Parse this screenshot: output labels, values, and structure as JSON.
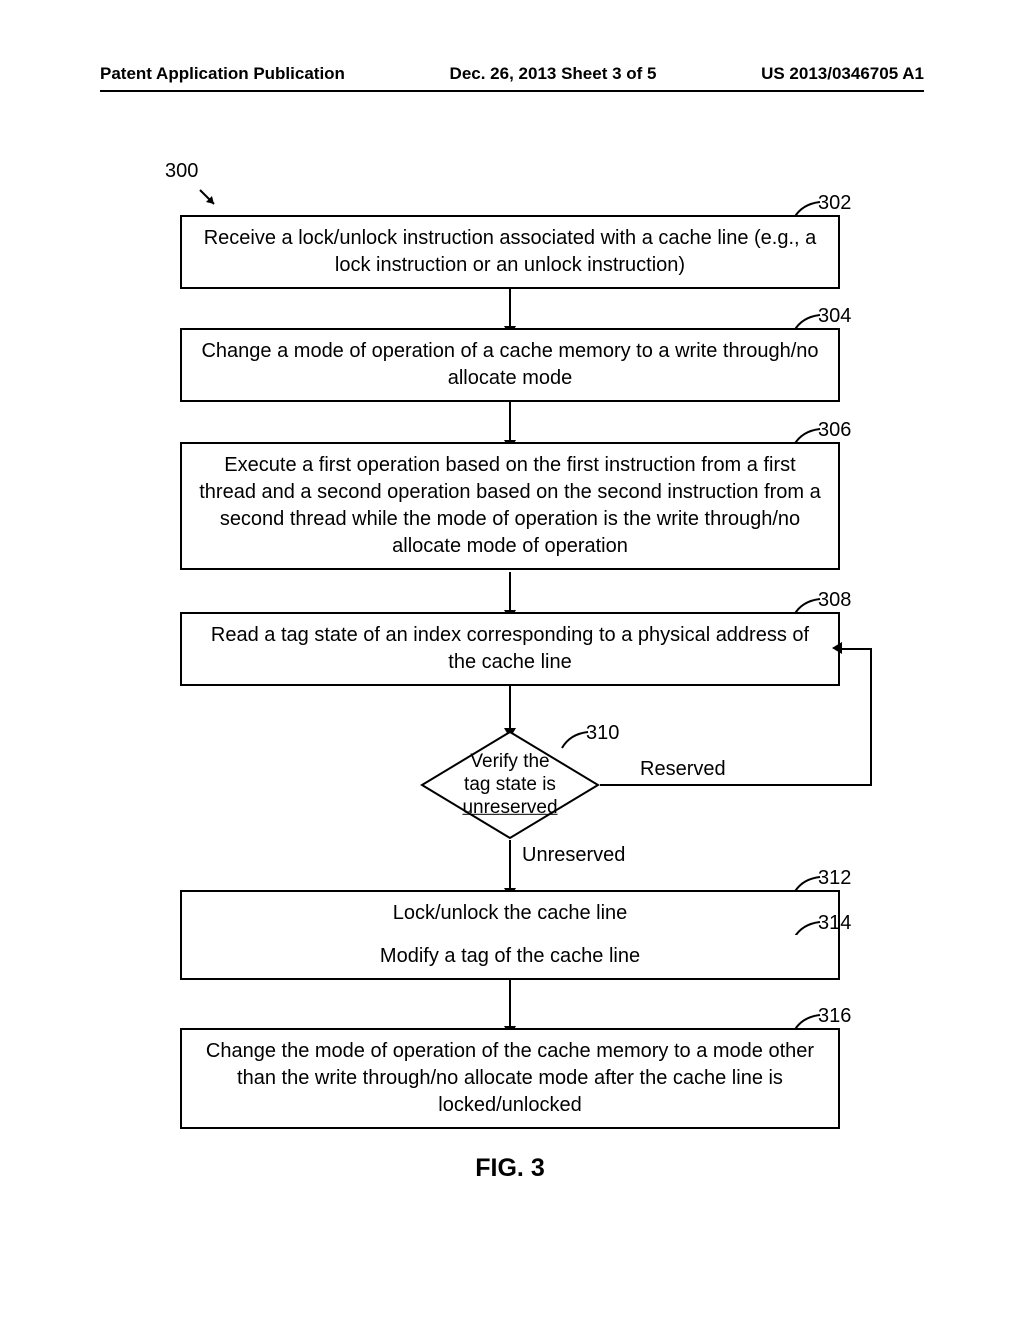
{
  "header": {
    "left": "Patent Application Publication",
    "center": "Dec. 26, 2013  Sheet 3 of 5",
    "right": "US 2013/0346705 A1"
  },
  "refs": {
    "r300": "300",
    "r302": "302",
    "r304": "304",
    "r306": "306",
    "r308": "308",
    "r310": "310",
    "r312": "312",
    "r314": "314",
    "r316": "316"
  },
  "boxes": {
    "b302": "Receive a lock/unlock instruction associated with a cache line (e.g., a lock instruction or an unlock instruction)",
    "b304": "Change a mode of operation of a cache memory to a write through/no allocate mode",
    "b306": "Execute a first operation based on the first instruction from a first thread and a second operation based on the second instruction from a second thread while the mode of operation is the write through/no allocate mode of operation",
    "b308": "Read a tag state of an index corresponding to a physical address of the cache line",
    "b312": "Lock/unlock the cache line",
    "b314": "Modify a tag of the cache line",
    "b316": "Change the mode of operation of the cache memory to a mode other than the write through/no allocate mode after the cache line is locked/unlocked"
  },
  "decision": {
    "line1": "Verify the",
    "line2": "tag state is",
    "line3": "unreserved",
    "right": "Reserved",
    "bottom": "Unreserved"
  },
  "caption": "FIG. 3",
  "chart_data": {
    "type": "flowchart",
    "title": "FIG. 3",
    "reference_numeral": "300",
    "nodes": [
      {
        "id": "302",
        "shape": "process",
        "text": "Receive a lock/unlock instruction associated with a cache line (e.g., a lock instruction or an unlock instruction)"
      },
      {
        "id": "304",
        "shape": "process",
        "text": "Change a mode of operation of a cache memory to a write through/no allocate mode"
      },
      {
        "id": "306",
        "shape": "process",
        "text": "Execute a first operation based on the first instruction from a first thread and a second operation based on the second instruction from a second thread while the mode of operation is the write through/no allocate mode of operation"
      },
      {
        "id": "308",
        "shape": "process",
        "text": "Read a tag state of an index corresponding to a physical address of the cache line"
      },
      {
        "id": "310",
        "shape": "decision",
        "text": "Verify the tag state is unreserved"
      },
      {
        "id": "312",
        "shape": "process",
        "text": "Lock/unlock the cache line"
      },
      {
        "id": "314",
        "shape": "process",
        "text": "Modify a tag of the cache line"
      },
      {
        "id": "316",
        "shape": "process",
        "text": "Change the mode of operation of the cache memory to a mode other than the write through/no allocate mode after the cache line is locked/unlocked"
      }
    ],
    "edges": [
      {
        "from": "302",
        "to": "304"
      },
      {
        "from": "304",
        "to": "306"
      },
      {
        "from": "306",
        "to": "308"
      },
      {
        "from": "308",
        "to": "310"
      },
      {
        "from": "310",
        "to": "308",
        "label": "Reserved"
      },
      {
        "from": "310",
        "to": "312",
        "label": "Unreserved"
      },
      {
        "from": "312",
        "to": "314"
      },
      {
        "from": "314",
        "to": "316"
      }
    ]
  }
}
